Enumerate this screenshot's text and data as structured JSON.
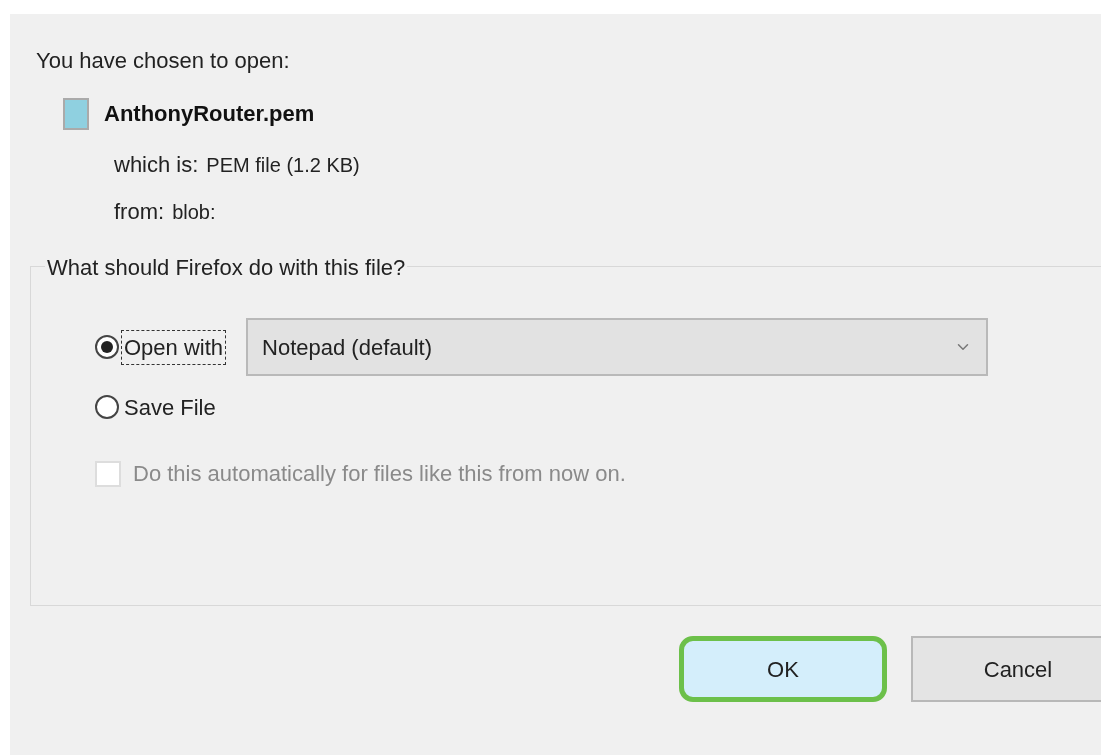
{
  "intro": "You have chosen to open:",
  "file": {
    "name": "AnthonyRouter.pem",
    "type_label": "which is:",
    "type_value": "PEM file (1.2 KB)",
    "from_label": "from:",
    "from_value": "blob:"
  },
  "action_group": {
    "title": "What should Firefox do with this file?",
    "options": [
      {
        "kind": "open",
        "label": "Open with",
        "selected": true,
        "focused": true,
        "app": "Notepad (default)"
      },
      {
        "kind": "save",
        "label": "Save File",
        "selected": false,
        "focused": false
      }
    ],
    "remember": {
      "label": "Do this automatically for files like this from now on.",
      "checked": false,
      "disabled": true
    }
  },
  "buttons": [
    {
      "label": "OK",
      "highlighted": true
    },
    {
      "label": "Cancel",
      "highlighted": false
    }
  ]
}
